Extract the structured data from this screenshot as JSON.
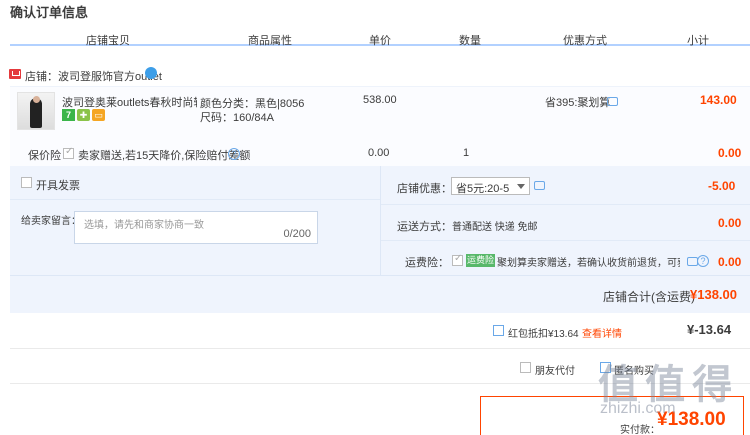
{
  "page_title": "确认订单信息",
  "columns": [
    "店铺宝贝",
    "商品属性",
    "单价",
    "数量",
    "优惠方式",
    "小计"
  ],
  "shop": {
    "label": "店铺：波司登服饰官方outlet"
  },
  "item": {
    "title": "波司登奥莱outlets春秋时尚轻...",
    "badge_7": "7",
    "attr_color": "颜色分类：黑色|8056",
    "attr_size": "尺码：160/84A",
    "unit_price": "538.00",
    "promo": "省395:聚划算",
    "subtotal": "143.00"
  },
  "insurance": {
    "label": "保价险",
    "desc": "卖家赠送,若15天降价,保险赔付差额",
    "price": "0.00",
    "qty": "1",
    "subtotal": "0.00"
  },
  "invoice": {
    "label": "开具发票"
  },
  "message": {
    "label": "给卖家留言：",
    "placeholder": "选填，请先和商家协商一致",
    "counter": "0/200"
  },
  "shop_discount": {
    "label": "店铺优惠：",
    "selected": "省5元:20-5",
    "amount": "-5.00"
  },
  "shipping": {
    "label": "运送方式：",
    "value": "普通配送 快递 免邮",
    "amount": "0.00"
  },
  "freight_insurance": {
    "label": "运费险：",
    "tag": "运费险",
    "desc": "聚划算卖家赠送，若确认收货前退货，可获...",
    "amount": "0.00"
  },
  "shop_total": {
    "label": "店铺合计(含运费)",
    "amount": "¥138.00"
  },
  "red_packet": {
    "label": "红包抵扣¥13.64",
    "link": "查看详情",
    "amount": "¥-13.64"
  },
  "friend_pay": {
    "label": "朋友代付"
  },
  "anon": {
    "label": "匿名购买"
  },
  "pay": {
    "label": "实付款：",
    "amount": "¥138.00"
  },
  "watermark": {
    "text": "值 值 得",
    "url": "zhizhi.com"
  }
}
